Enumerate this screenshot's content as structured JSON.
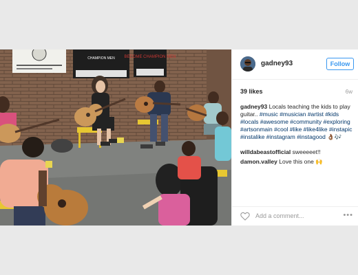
{
  "post": {
    "username": "gadney93",
    "follow_label": "Follow",
    "likes": "39 likes",
    "time_ago": "6w",
    "caption": {
      "author": "gadney93",
      "text": "Locals teaching the kids to play guitar..",
      "hashtags": "#music #musician #artist #kids #locals #awesome #community #exploring #artsonmain #cool #like #like4like #instapic #instalike #instagram #instagood",
      "emoji": "👌🏾🎶"
    },
    "comments": [
      {
        "author": "willdabeastofficial",
        "text": "sweeeeet!!"
      },
      {
        "author": "damon.valley",
        "text": "Love this one 🙌"
      }
    ],
    "add_comment_placeholder": "Add a comment...",
    "more_label": "•••",
    "icons": {
      "like": "heart-icon",
      "more": "more-options-icon"
    }
  },
  "photo": {
    "posters": [
      {
        "text": "CHAMPION MEN"
      },
      {
        "text": "BECOME CHAMPION MEN"
      }
    ]
  },
  "colors": {
    "accent": "#3897f0",
    "tag": "#003569",
    "muted": "#999999"
  }
}
